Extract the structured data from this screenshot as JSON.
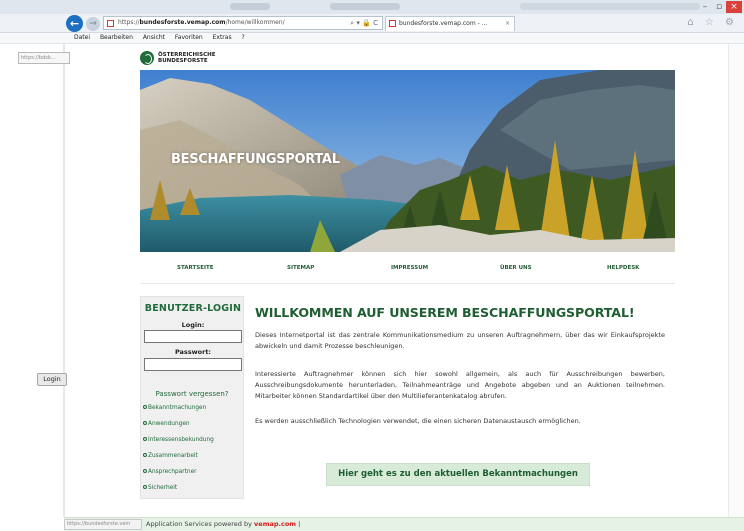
{
  "browser": {
    "address_prefix": "https://",
    "address_host": "bundesforste.vemap.com",
    "address_path": "/home/willkommen/",
    "address_icons": "⌕ ▾ 🔒 C",
    "tab_title": "bundesforste.vemap.com - ...",
    "tab_close": "×",
    "menu": [
      "Datei",
      "Bearbeiten",
      "Ansicht",
      "Favoriten",
      "Extras",
      "?"
    ],
    "tooltip": "https://bdsk...",
    "status_url": "https://bundesforste.vem",
    "right_icons": "⌂ ☆ ⚙"
  },
  "logo": {
    "line1": "ÖSTERREICHISCHE",
    "line2": "BUNDESFORSTE"
  },
  "hero": {
    "title": "BESCHAFFUNGSPORTAL"
  },
  "nav": [
    "STARTSEITE",
    "SITEMAP",
    "IMPRESSUM",
    "ÜBER UNS",
    "HELPDESK"
  ],
  "login": {
    "title": "BENUTZER-LOGIN",
    "login_label": "Login:",
    "password_label": "Passwort:",
    "login_value": "",
    "password_value": "",
    "button": "Login",
    "forgot": "Passwort vergessen?"
  },
  "side_links": [
    "Bekanntmachungen",
    "Anwendungen",
    "Interessensbekundung",
    "Zusammenarbeit",
    "Ansprechpartner",
    "Sicherheit"
  ],
  "content": {
    "title": "WILLKOMMEN AUF UNSEREM BESCHAFFUNGSPORTAL!",
    "p1": "Dieses Internetportal ist das zentrale Kommunikationsmedium zu unseren Auftragnehmern, über das wir Einkaufsprojekte abwickeln und damit Prozesse beschleunigen.",
    "p2": "Interessierte Auftragnehmer können sich hier sowohl allgemein, als auch für Ausschreibungen bewerben, Ausschreibungsdokumente herunterladen, Teilnahmeanträge und Angebote abgeben und an Auktionen teilnehmen. Mitarbeiter können Standardartikel über den Multilieferantenkatalog abrufen.",
    "p3": "Es werden ausschließlich Technologien verwendet, die einen sicheren Datenaustausch ermöglichen.",
    "cta": "Hier geht es zu den aktuellen Bekanntmachungen"
  },
  "footer": {
    "text": "Application Services powered by ",
    "brand": "vemap.com",
    "suffix": " |"
  },
  "colors": {
    "brand_green": "#1f5e33",
    "cta_bg": "#d8ebd9",
    "footer_bg": "#e6f2e6",
    "browser_blue": "#1d6fc2"
  }
}
